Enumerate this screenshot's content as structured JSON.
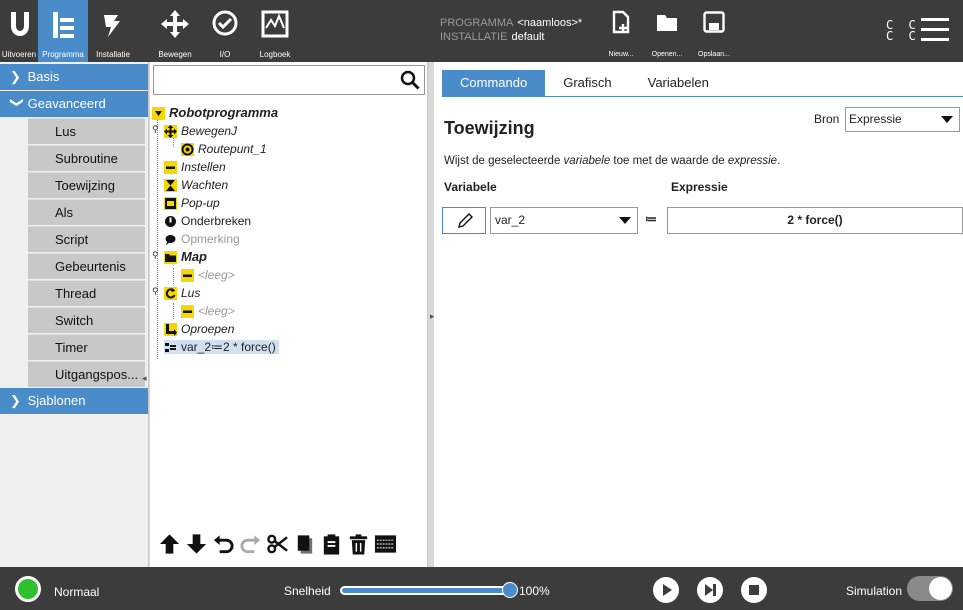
{
  "header": {
    "nav": [
      {
        "label": "Uitvoeren",
        "icon": "ur-logo-icon"
      },
      {
        "label": "Programma",
        "icon": "program-icon",
        "active": true
      },
      {
        "label": "Installatie",
        "icon": "installation-icon"
      },
      {
        "label": "Bewegen",
        "icon": "move-icon"
      },
      {
        "label": "I/O",
        "icon": "io-icon"
      },
      {
        "label": "Logboek",
        "icon": "log-icon"
      }
    ],
    "program_key": "PROGRAMMA",
    "program_value": "<naamloos>*",
    "installation_key": "INSTALLATIE",
    "installation_value": "default",
    "file_buttons": {
      "new": "Nieuw...",
      "open": "Openen...",
      "save": "Opslaan..."
    },
    "cc_text_1": "C C",
    "cc_text_2": "C C"
  },
  "sidebar": {
    "basis": "Basis",
    "geavanceerd": "Geavanceerd",
    "items": [
      "Lus",
      "Subroutine",
      "Toewijzing",
      "Als",
      "Script",
      "Gebeurtenis",
      "Thread",
      "Switch",
      "Timer",
      "Uitgangspos..."
    ],
    "sjablonen": "Sjablonen"
  },
  "tree": {
    "search_placeholder": "",
    "nodes": {
      "root": "Robotprogramma",
      "bewegen": "BewegenJ",
      "routepunt": "Routepunt_1",
      "instellen": "Instellen",
      "wachten": "Wachten",
      "popup": "Pop-up",
      "onderbreken": "Onderbreken",
      "opmerking": "Opmerking",
      "map": "Map",
      "leeg1": "<leeg>",
      "lus": "Lus",
      "leeg2": "<leeg>",
      "oproepen": "Oproepen",
      "assign": "var_2≔2 * force()"
    }
  },
  "command": {
    "tabs": [
      "Commando",
      "Grafisch",
      "Variabelen"
    ],
    "title": "Toewijzing",
    "bron_label": "Bron",
    "bron_value": "Expressie",
    "desc_a": "Wijst de geselecteerde ",
    "desc_b": "variabele",
    "desc_c": " toe met de waarde de ",
    "desc_d": "expressie",
    "desc_e": ".",
    "variabele_label": "Variabele",
    "expressie_label": "Expressie",
    "variable_value": "var_2",
    "assign_op": "≔",
    "expression_value": "2 * force()"
  },
  "footer": {
    "status": "Normaal",
    "speed_label": "Snelheid",
    "speed_value": "100%",
    "speed_fraction": 1.0,
    "simulation_label": "Simulation"
  },
  "colors": {
    "accent": "#4a8bc9",
    "header": "#3c3c3c",
    "status_ok": "#2ec02e",
    "node_yellow": "#f5d800"
  }
}
